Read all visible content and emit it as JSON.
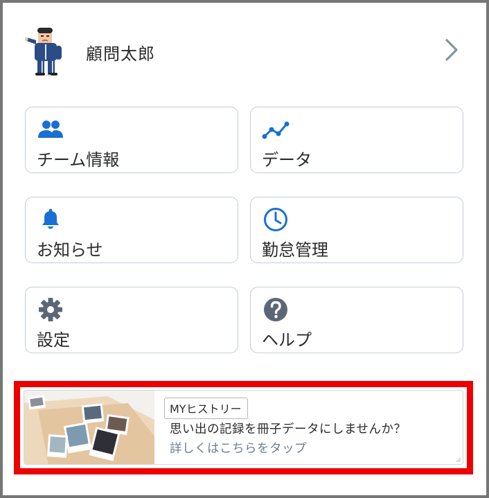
{
  "profile": {
    "name": "顧問太郎",
    "avatar_icon": "coach-avatar-icon",
    "chevron_icon": "chevron-right-icon"
  },
  "menu": [
    {
      "id": "team-info",
      "label": "チーム情報",
      "icon": "people-icon"
    },
    {
      "id": "data",
      "label": "データ",
      "icon": "trend-line-icon"
    },
    {
      "id": "notifications",
      "label": "お知らせ",
      "icon": "bell-icon"
    },
    {
      "id": "attendance",
      "label": "勤怠管理",
      "icon": "clock-icon"
    },
    {
      "id": "settings",
      "label": "設定",
      "icon": "gear-icon"
    },
    {
      "id": "help",
      "label": "ヘルプ",
      "icon": "question-icon"
    }
  ],
  "banner": {
    "tag": "MYヒストリー",
    "text": "思い出の記録を冊子データにしませんか？",
    "link": "詳しくはこちらをタップ"
  },
  "colors": {
    "icon_blue": "#1a6fd4",
    "icon_gray": "#5b6775",
    "tile_border": "#c3cdd8",
    "highlight_red": "#ee0000",
    "frame_gray": "#767676"
  }
}
